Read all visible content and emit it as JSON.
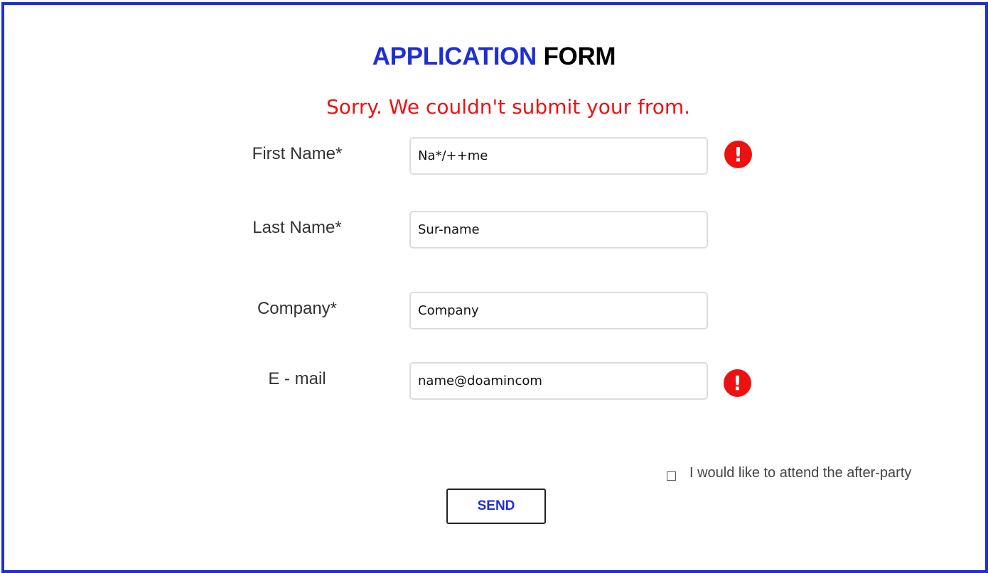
{
  "title": {
    "accent": "APPLICATION",
    "rest": "FORM"
  },
  "error_message": "Sorry. We couldn't submit your from.",
  "fields": [
    {
      "label": "First Name*",
      "value": "Na*/++me",
      "has_error": true,
      "error_icon": "exclamation-circle-icon"
    },
    {
      "label": "Last Name*",
      "value": "Sur-name",
      "has_error": false
    },
    {
      "label": "Company*",
      "value": "Company",
      "has_error": false
    },
    {
      "label": "E - mail",
      "value": "name@doamincom",
      "has_error": true,
      "error_icon": "exclamation-circle-icon"
    }
  ],
  "error_icon_glyph": "!",
  "checkbox": {
    "label": "I would like to attend the after-party",
    "checked": false
  },
  "send_label": "SEND",
  "colors": {
    "accent": "#1f2fd6",
    "error": "#ee1111",
    "text": "#333333"
  }
}
